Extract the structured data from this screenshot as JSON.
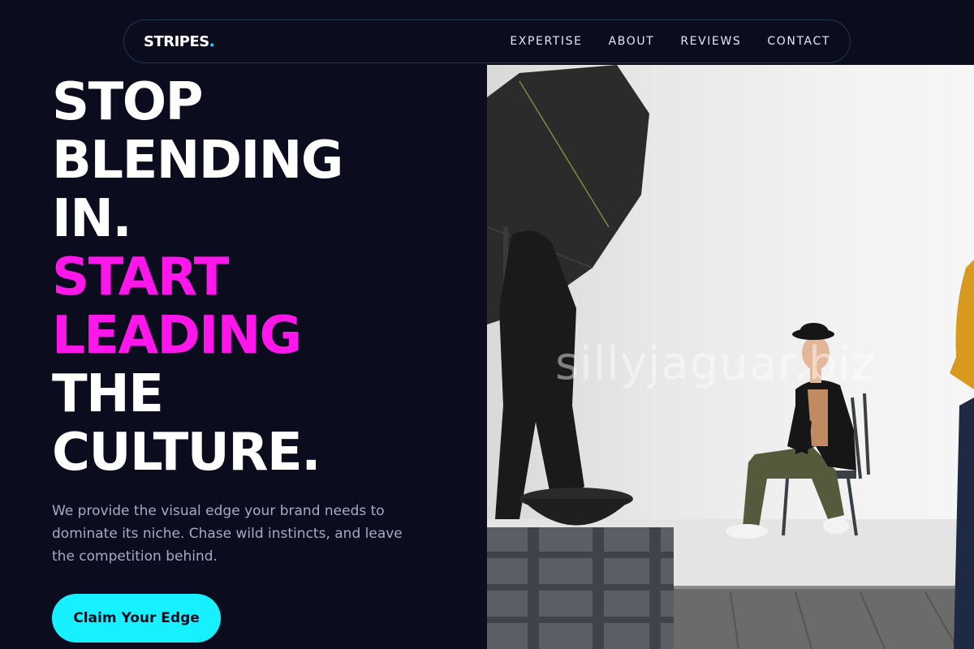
{
  "nav": {
    "brand": "STRIPES",
    "brand_dot": ".",
    "links": [
      "EXPERTISE",
      "ABOUT",
      "REVIEWS",
      "CONTACT"
    ]
  },
  "hero": {
    "title_lines": [
      "STOP",
      "BLENDING",
      "IN.",
      "START",
      "LEADING",
      "THE",
      "CULTURE."
    ],
    "description": "We provide the visual edge your brand needs to dominate its niche. Chase wild instincts, and leave the competition behind.",
    "cta_label": "Claim Your Edge"
  },
  "photo": {
    "subject": "photo-studio-man-seated-on-chair",
    "watermark": "sillyjaguar.biz"
  },
  "colors": {
    "background": "#0b0c1e",
    "accent_magenta": "#ff16ea",
    "accent_cyan": "#17f0ff",
    "text_muted": "#a7aac0",
    "nav_border": "#1f3a4a"
  }
}
